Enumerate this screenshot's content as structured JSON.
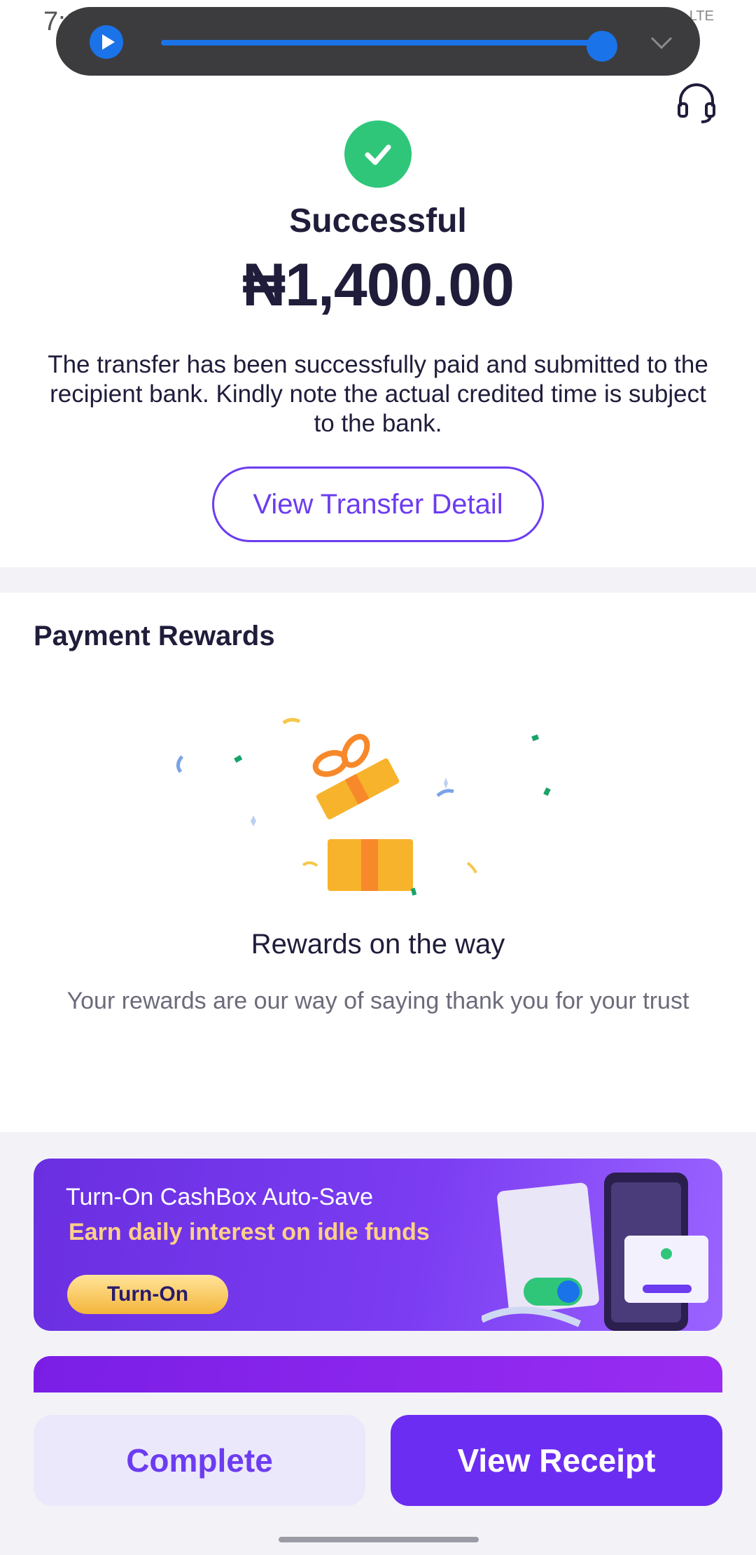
{
  "status_bar": {
    "time": "7:17",
    "network": "LTE"
  },
  "colors": {
    "accent": "#6c3cf0",
    "success": "#2fc67a",
    "text": "#1f1d3a",
    "muted": "#6b6b7b",
    "media_blue": "#1a73e8"
  },
  "media": {
    "progress": 0.98
  },
  "result": {
    "title": "Successful",
    "amount": "₦1,400.00",
    "description": "The transfer has been successfully paid and submitted to the recipient bank. Kindly note the actual credited time is subject to the bank.",
    "detail_button": "View Transfer Detail"
  },
  "rewards": {
    "section_title": "Payment Rewards",
    "heading": "Rewards on the way",
    "description": "Your rewards are our way of saying thank you for your trust"
  },
  "banners": {
    "cashbox": {
      "title": "Turn-On CashBox Auto-Save",
      "subtitle": "Earn daily interest on idle funds",
      "button": "Turn-On"
    }
  },
  "actions": {
    "complete": "Complete",
    "receipt": "View Receipt"
  }
}
